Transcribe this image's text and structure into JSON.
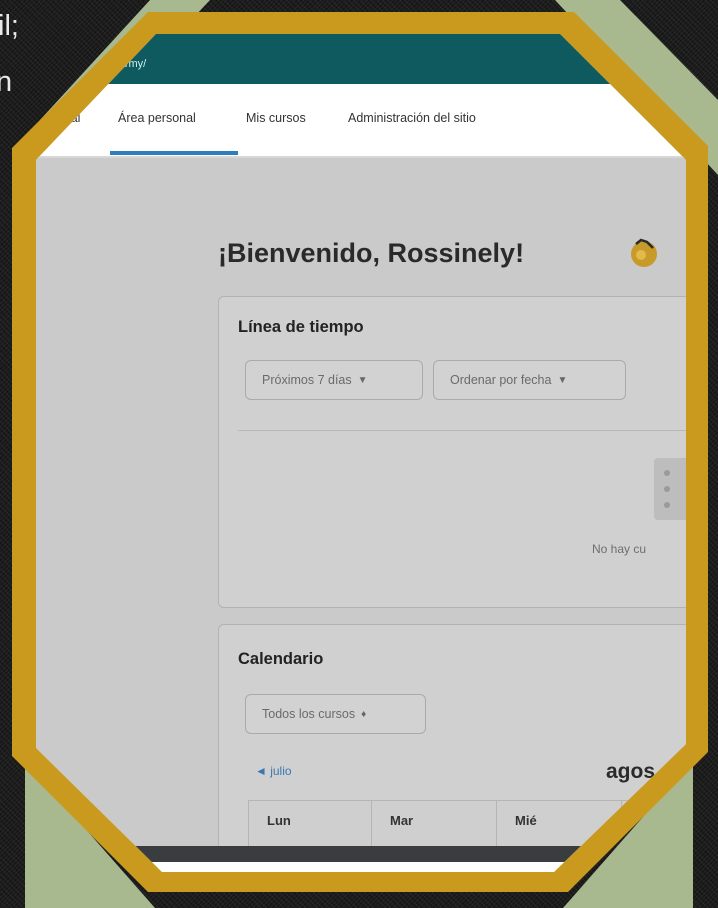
{
  "background_snippet": {
    "line1": "il;",
    "line2": "n"
  },
  "colors": {
    "frame_gold": "#c99a1d",
    "corner_green": "#a8b88f",
    "topbar": "#0e5a5f",
    "nav_active": "#2c7fba",
    "link": "#3b77b0"
  },
  "topbar": {
    "site_text": "icit/my/"
  },
  "nav": {
    "items": [
      {
        "label": "ipal"
      },
      {
        "label": "Área personal"
      },
      {
        "label": "Mis cursos"
      },
      {
        "label": "Administración del sitio"
      }
    ],
    "active_index": 1
  },
  "welcome": {
    "text": "¡Bienvenido, Rossinely!",
    "icon": "waving-hand-icon"
  },
  "timeline": {
    "title": "Línea de tiempo",
    "filter_days": "Próximos 7 días",
    "sort_by": "Ordenar por fecha",
    "empty_icon": "empty-list-icon",
    "empty_text": "No hay cu"
  },
  "calendar": {
    "title": "Calendario",
    "course_filter": "Todos los cursos",
    "prev_month": "◄ julio",
    "month": "agos",
    "weekdays": [
      "Lun",
      "Mar",
      "Mié",
      ""
    ]
  }
}
